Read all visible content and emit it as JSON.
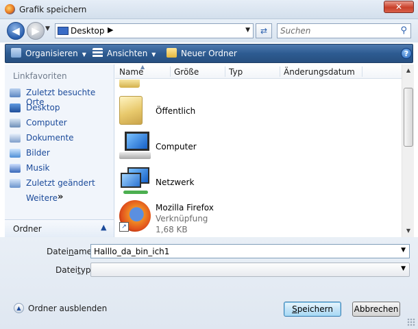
{
  "window": {
    "title": "Grafik speichern",
    "close_glyph": "✕"
  },
  "address": {
    "location": "Desktop",
    "search_placeholder": "Suchen"
  },
  "toolbar": {
    "organize": "Organisieren",
    "views": "Ansichten",
    "new_folder": "Neuer Ordner",
    "help": "?"
  },
  "nav": {
    "heading": "Linkfavoriten",
    "items": [
      {
        "label": "Zuletzt besuchte Orte",
        "icon": "recent-places-icon"
      },
      {
        "label": "Desktop",
        "icon": "desktop-icon"
      },
      {
        "label": "Computer",
        "icon": "computer-icon"
      },
      {
        "label": "Dokumente",
        "icon": "documents-icon"
      },
      {
        "label": "Bilder",
        "icon": "pictures-icon"
      },
      {
        "label": "Musik",
        "icon": "music-icon"
      },
      {
        "label": "Zuletzt geändert",
        "icon": "recently-changed-icon"
      }
    ],
    "more": "Weitere",
    "more_glyph": "»",
    "folders": "Ordner"
  },
  "columns": {
    "name": "Name",
    "size": "Größe",
    "type": "Typ",
    "date": "Änderungsdatum"
  },
  "files": [
    {
      "name": "Öffentlich",
      "icon": "folder-icon"
    },
    {
      "name": "Computer",
      "icon": "computer-icon"
    },
    {
      "name": "Netzwerk",
      "icon": "network-icon"
    },
    {
      "name": "Mozilla Firefox",
      "type": "Verknüpfung",
      "size": "1,68 KB",
      "icon": "firefox-icon"
    }
  ],
  "form": {
    "filename_label_pre": "Datei",
    "filename_label_ul": "n",
    "filename_label_post": "ame:",
    "filename_value": "Halllo_da_bin_ich1",
    "filetype_label_pre": "Datei",
    "filetype_label_ul": "t",
    "filetype_label_post": "yp:",
    "filetype_value": ""
  },
  "footer": {
    "hide_folders": "Ordner ausblenden",
    "save_pre": "",
    "save_ul": "S",
    "save_post": "peichern",
    "cancel": "Abbrechen"
  },
  "colors": {
    "toolbar": "#2d5b91",
    "link": "#1b4a9a"
  }
}
